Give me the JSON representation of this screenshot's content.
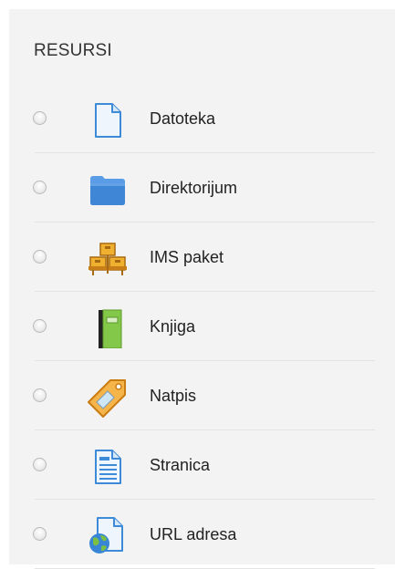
{
  "section": {
    "title": "RESURSI"
  },
  "resources": [
    {
      "label": "Datoteka",
      "icon": "file-icon"
    },
    {
      "label": "Direktorijum",
      "icon": "folder-icon"
    },
    {
      "label": "IMS paket",
      "icon": "package-icon"
    },
    {
      "label": "Knjiga",
      "icon": "book-icon"
    },
    {
      "label": "Natpis",
      "icon": "label-tag-icon"
    },
    {
      "label": "Stranica",
      "icon": "page-icon"
    },
    {
      "label": "URL adresa",
      "icon": "url-globe-icon"
    }
  ],
  "colors": {
    "panel_background": "#f3f3f3",
    "divider": "#e3e3e3",
    "file_blue": "#2a7fd4",
    "folder_blue": "#4a90e2",
    "package_orange": "#e8a020",
    "book_green": "#7cc043",
    "tag_orange": "#f0a030"
  }
}
